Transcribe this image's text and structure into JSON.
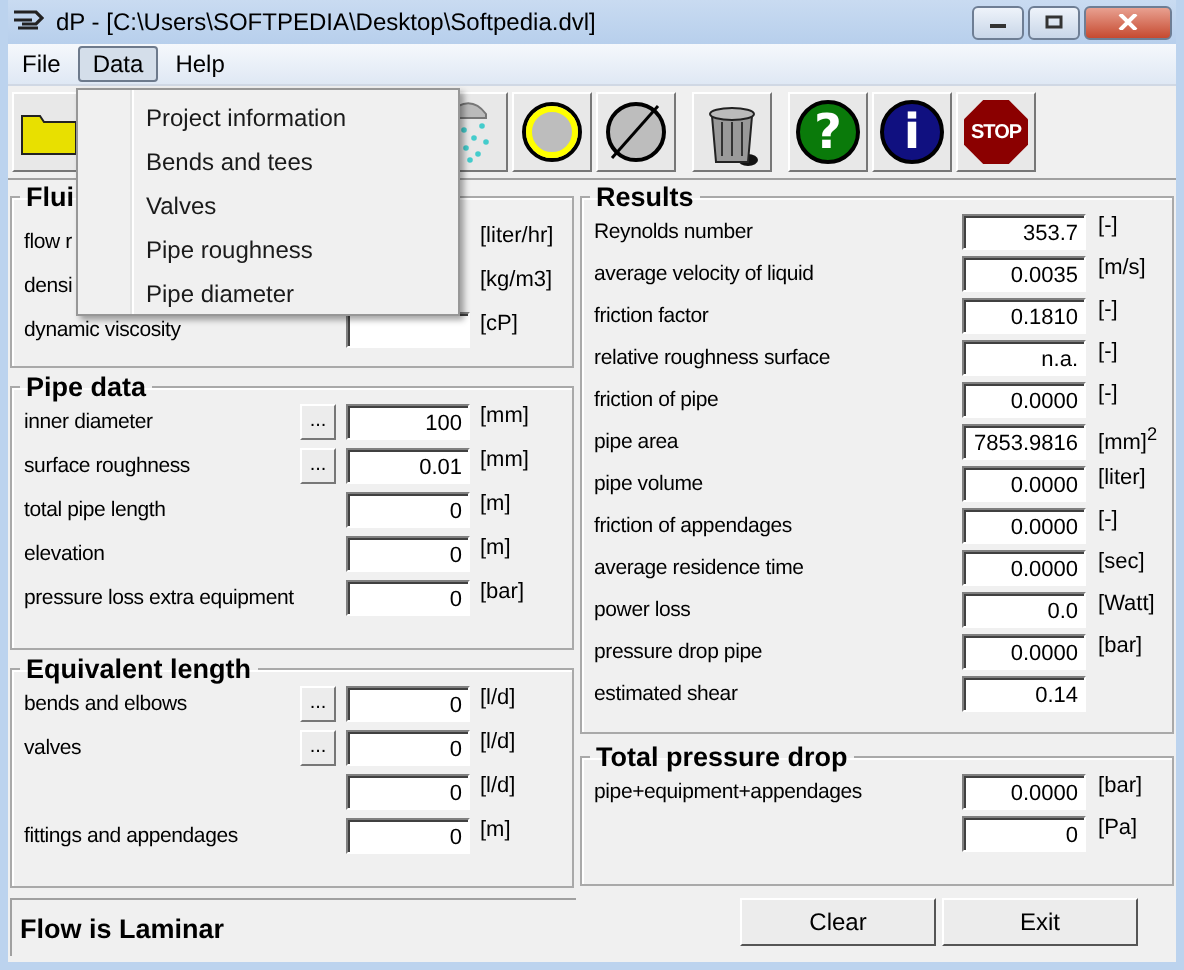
{
  "window": {
    "title": "dP - [C:\\Users\\SOFTPEDIA\\Desktop\\Softpedia.dvl]"
  },
  "menu": [
    {
      "label": "File",
      "selected": false
    },
    {
      "label": "Data",
      "selected": true
    },
    {
      "label": "Help",
      "selected": false
    }
  ],
  "dropdown": [
    "Project information",
    "Bends and tees",
    "Valves",
    "Pipe roughness",
    "Pipe diameter"
  ],
  "toolbar": [
    {
      "kind": "folder"
    },
    {
      "kind": "shower"
    },
    {
      "kind": "ring"
    },
    {
      "kind": "slashed"
    },
    {
      "kind": "trash"
    },
    {
      "kind": "help",
      "text": "?"
    },
    {
      "kind": "info",
      "text": "i"
    },
    {
      "kind": "stop",
      "text": "STOP"
    }
  ],
  "fluid": {
    "title": "Flui",
    "rows": [
      {
        "label": "flow r",
        "unit": "[liter/hr]",
        "field_shown": false
      },
      {
        "label": "densi",
        "unit": "[kg/m3]",
        "field_shown": false
      },
      {
        "label": "dynamic viscosity",
        "unit": "[cP]",
        "field_shown": true
      }
    ]
  },
  "pipe_data": {
    "title": "Pipe data",
    "rows": [
      {
        "label": "inner diameter",
        "browse": "...",
        "value": "100",
        "unit": "[mm]"
      },
      {
        "label": "surface roughness",
        "browse": "...",
        "value": "0.01",
        "unit": "[mm]"
      },
      {
        "label": "total pipe length",
        "value": "0",
        "unit": "[m]"
      },
      {
        "label": "elevation",
        "value": "0",
        "unit": "[m]"
      },
      {
        "label": "pressure loss extra equipment",
        "value": "0",
        "unit": "[bar]"
      }
    ]
  },
  "equivalent_length": {
    "title": "Equivalent length",
    "rows": [
      {
        "label": "bends and elbows",
        "browse": "...",
        "value": "0",
        "unit": "[l/d]"
      },
      {
        "label": "valves",
        "browse": "...",
        "value": "0",
        "unit": "[l/d]"
      },
      {
        "value": "0",
        "unit": "[l/d]"
      },
      {
        "label": "fittings and appendages",
        "value": "0",
        "unit": "[m]"
      }
    ]
  },
  "results": {
    "title": "Results",
    "rows": [
      {
        "label": "Reynolds number",
        "value": "353.7",
        "unit": "[-]"
      },
      {
        "label": "average velocity of liquid",
        "value": "0.0035",
        "unit": "[m/s]"
      },
      {
        "label": "friction factor",
        "value": "0.1810",
        "unit": "[-]"
      },
      {
        "label": "relative roughness surface",
        "value": "n.a.",
        "unit": "[-]"
      },
      {
        "label": "friction of pipe",
        "value": "0.0000",
        "unit": "[-]"
      },
      {
        "label": "pipe area",
        "value": "7853.9816",
        "unit": "[mm]$^{2}$"
      },
      {
        "label": "pipe volume",
        "value": "0.0000",
        "unit": "[liter]"
      },
      {
        "label": "friction of appendages",
        "value": "0.0000",
        "unit": "[-]"
      },
      {
        "label": "average residence time",
        "value": "0.0000",
        "unit": "[sec]"
      },
      {
        "label": "power loss",
        "value": "0.0",
        "unit": "[Watt]"
      },
      {
        "label": "pressure drop pipe",
        "value": "0.0000",
        "unit": "[bar]"
      },
      {
        "label": "estimated shear",
        "value": "0.14"
      }
    ]
  },
  "total_pressure_drop": {
    "title": "Total pressure drop",
    "rows": [
      {
        "label": "pipe+equipment+appendages",
        "value": "0.0000",
        "unit": "[bar]"
      },
      {
        "value": "0",
        "unit": "[Pa]"
      }
    ]
  },
  "status": "Flow is Laminar",
  "buttons": [
    "Clear",
    "Exit"
  ]
}
